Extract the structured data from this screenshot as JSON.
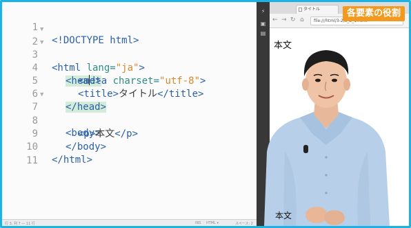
{
  "editor": {
    "lines": [
      {
        "n": "1",
        "fold": "",
        "code": "<!DOCTYPE html>"
      },
      {
        "n": "2",
        "fold": "▼",
        "code": "<html lang=\"ja\">"
      },
      {
        "n": "3",
        "fold": "▼",
        "code": "<head>"
      },
      {
        "n": "4",
        "fold": "",
        "code": "<meta charset=\"utf-8\">"
      },
      {
        "n": "5",
        "fold": "",
        "code": "<title>タイトル</title>"
      },
      {
        "n": "6",
        "fold": "",
        "code": "</head>"
      },
      {
        "n": "7",
        "fold": "▼",
        "code": "<body>"
      },
      {
        "n": "8",
        "fold": "",
        "code": "<p>本文</p>"
      },
      {
        "n": "9",
        "fold": "",
        "code": "</body>"
      },
      {
        "n": "10",
        "fold": "",
        "code": "</html>"
      },
      {
        "n": "11",
        "fold": "",
        "code": ""
      }
    ]
  },
  "statusbar": {
    "position": "行 3, 列 7 — 11 行",
    "ins": "INS",
    "mode": "HTML ▾",
    "spaces": "スペース: 2"
  },
  "browser": {
    "tab_title": "タイトル",
    "address": "file:///html/3-2/3_2_1.html",
    "body_text": "本文",
    "body_text_bottom": "本文"
  },
  "badge": {
    "text": "各要素の役割",
    "color": "#f29a1f"
  },
  "colors": {
    "frame": "#19b3e6",
    "tag": "#2a5fa8",
    "attr": "#2e8b87",
    "value": "#d7882a",
    "highlight": "#d3ecd9"
  }
}
